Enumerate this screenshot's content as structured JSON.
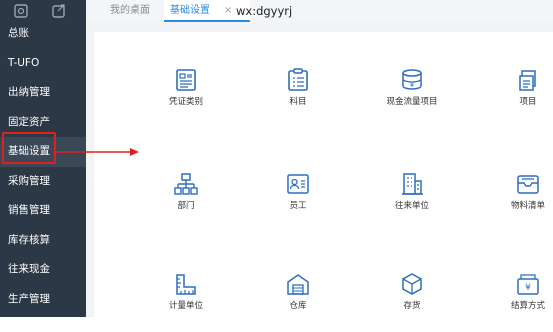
{
  "tabs": {
    "home": "我的桌面",
    "active": "基础设置",
    "close": "×",
    "user": "wx:dgyyrj"
  },
  "sidebar": {
    "items": [
      {
        "label": "总账"
      },
      {
        "label": "T-UFO"
      },
      {
        "label": "出纳管理"
      },
      {
        "label": "固定资产"
      },
      {
        "label": "基础设置"
      },
      {
        "label": "采购管理"
      },
      {
        "label": "销售管理"
      },
      {
        "label": "库存核算"
      },
      {
        "label": "往来现金"
      },
      {
        "label": "生产管理"
      }
    ]
  },
  "tiles": [
    {
      "label": "凭证类别",
      "icon": "voucher-icon"
    },
    {
      "label": "科目",
      "icon": "subject-icon"
    },
    {
      "label": "现金流量项目",
      "icon": "cashflow-icon"
    },
    {
      "label": "项目",
      "icon": "project-icon"
    },
    {
      "label": "部门",
      "icon": "department-icon"
    },
    {
      "label": "员工",
      "icon": "employee-icon"
    },
    {
      "label": "往来单位",
      "icon": "partner-icon"
    },
    {
      "label": "物料清单",
      "icon": "bom-icon"
    },
    {
      "label": "计量单位",
      "icon": "unit-icon"
    },
    {
      "label": "仓库",
      "icon": "warehouse-icon"
    },
    {
      "label": "存货",
      "icon": "inventory-icon"
    },
    {
      "label": "结算方式",
      "icon": "settlement-icon"
    }
  ],
  "colors": {
    "sidebar_bg": "#2c3845",
    "accent": "#2a8ce0",
    "icon_blue": "#2d6fbd",
    "highlight": "#e02020"
  }
}
